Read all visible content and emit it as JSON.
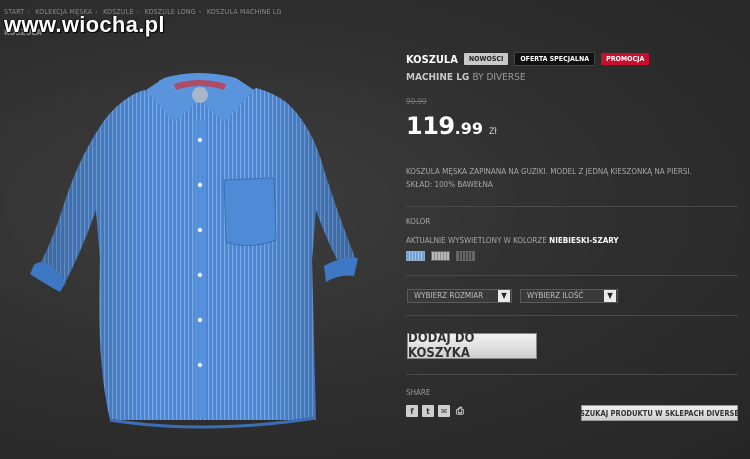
{
  "breadcrumb": [
    "START",
    "KOLEKCJA MĘSKA",
    "KOSZULE",
    "KOSZULE LONG",
    "KOSZULA MACHINE LG"
  ],
  "watermark": "www.wiocha.pl",
  "page_heading": "KOSZULA",
  "product": {
    "title": "KOSZULA",
    "badges": [
      "NOWOŚCI",
      "OFERTA SPECJALNA",
      "PROMOCJA"
    ],
    "name": "MACHINE LG",
    "brand": "BY DIVERSE",
    "old_price": "99.99",
    "price_int": "119",
    "price_dec": ".99",
    "currency": "Zł",
    "description_line1": "KOSZULA MĘSKA ZAPINANA NA GUZIKI. MODEL Z JEDNĄ KIESZONKĄ NA PIERSI.",
    "description_line2": "SKŁAD: 100% BAWEŁNA"
  },
  "color": {
    "label": "KOLOR",
    "current_prefix": "AKTUALNIE WYŚWIETLONY W KOLORZE",
    "current_value": "NIEBIESKI-SZARY",
    "swatches": [
      "blue",
      "light-gray",
      "dark-gray"
    ]
  },
  "selects": {
    "size": "WYBIERZ ROZMIAR",
    "quantity": "WYBIERZ ILOŚĆ"
  },
  "add_to_cart": "DODAJ DO KOSZYKA",
  "share": {
    "label": "SHARE",
    "icons": [
      "facebook-icon",
      "twitter-icon",
      "email-icon",
      "print-icon"
    ]
  },
  "find_in_stores": "SZUKAJ PRODUKTU W SKLEPACH DIVERSE",
  "colors": {
    "background": "#2f2f2f",
    "promo": "#c8102e",
    "shirt": "#4a86d4"
  }
}
